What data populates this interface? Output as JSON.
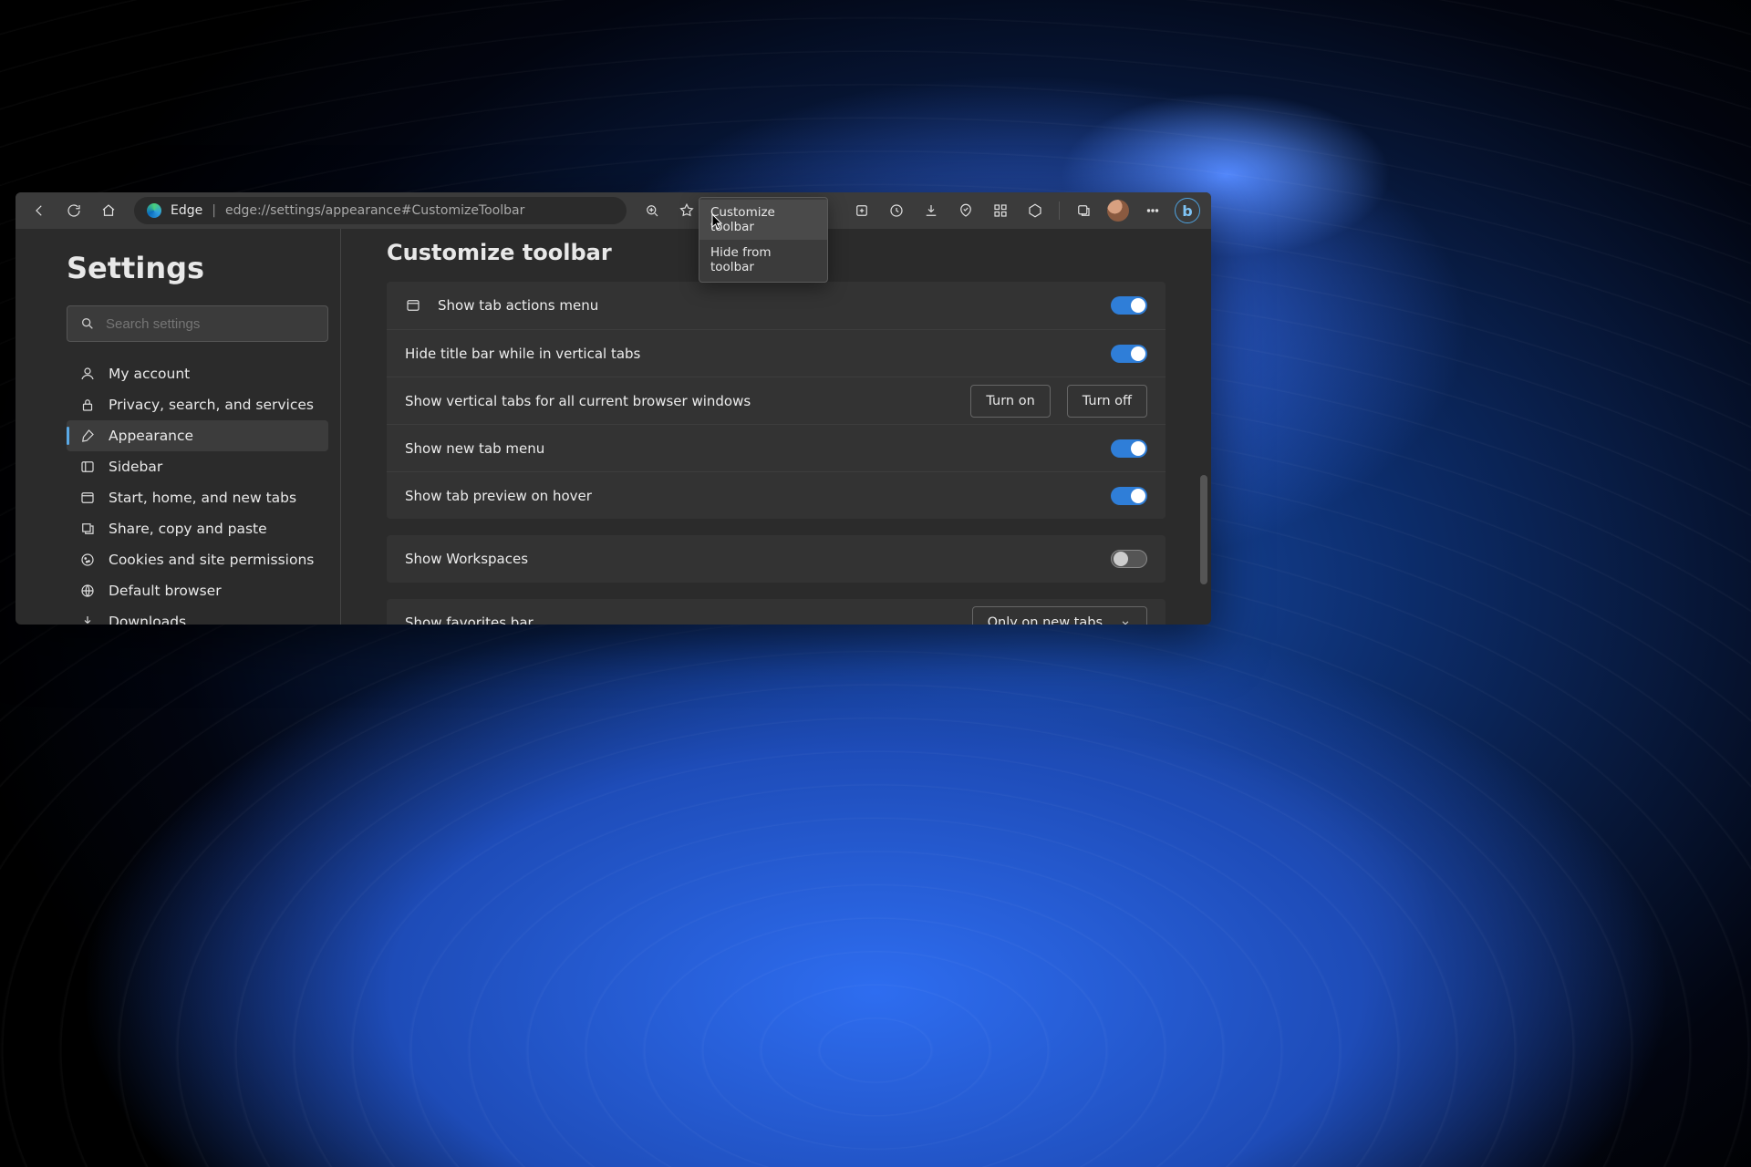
{
  "toolbar": {
    "edge_label": "Edge",
    "url": "edge://settings/appearance#CustomizeToolbar"
  },
  "context_menu": {
    "items": [
      "Customize toolbar",
      "Hide from toolbar"
    ]
  },
  "sidebar": {
    "title": "Settings",
    "search_placeholder": "Search settings",
    "items": [
      "My account",
      "Privacy, search, and services",
      "Appearance",
      "Sidebar",
      "Start, home, and new tabs",
      "Share, copy and paste",
      "Cookies and site permissions",
      "Default browser",
      "Downloads"
    ],
    "active_index": 2
  },
  "main": {
    "heading": "Customize toolbar",
    "rows": {
      "tab_actions": "Show tab actions menu",
      "hide_title": "Hide title bar while in vertical tabs",
      "vertical_tabs": "Show vertical tabs for all current browser windows",
      "new_tab_menu": "Show new tab menu",
      "tab_preview": "Show tab preview on hover",
      "workspaces": "Show Workspaces",
      "favorites": "Show favorites bar"
    },
    "btn_on": "Turn on",
    "btn_off": "Turn off",
    "favorites_value": "Only on new tabs"
  }
}
